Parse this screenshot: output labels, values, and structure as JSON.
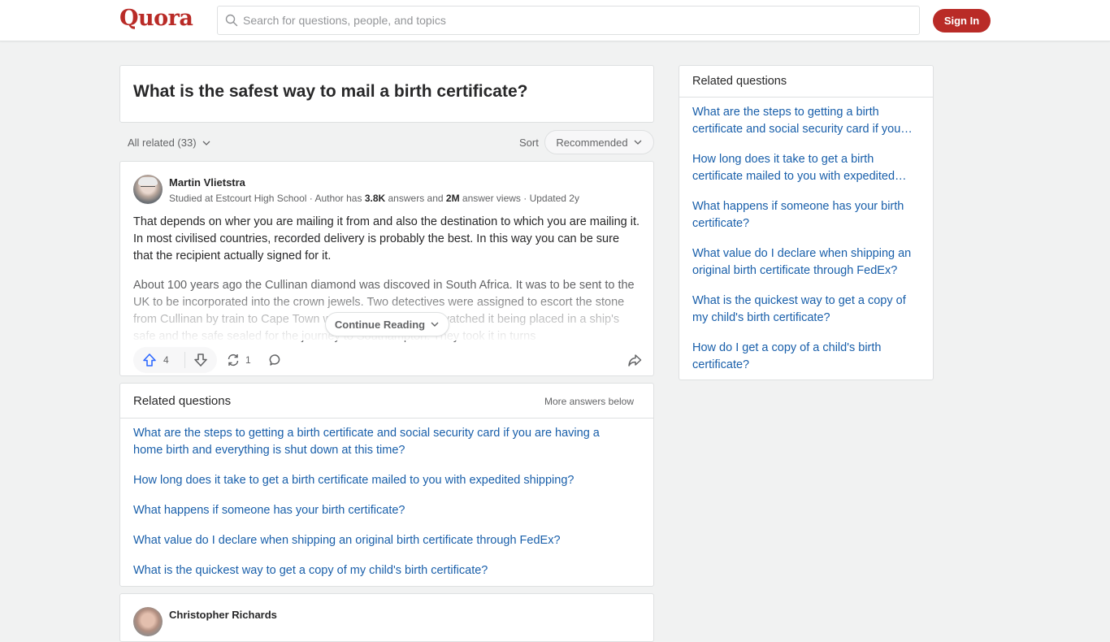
{
  "header": {
    "logo": "Quora",
    "search_placeholder": "Search for questions, people, and topics",
    "sign_in_label": "Sign In"
  },
  "question": {
    "title": "What is the safest way to mail a birth certificate?"
  },
  "filters": {
    "all_related_label": "All related (33)",
    "sort_label": "Sort",
    "sort_value": "Recommended"
  },
  "answer": {
    "author_name": "Martin Vlietstra",
    "credential": "Studied at Estcourt High School",
    "meta_prefix": " · Author has ",
    "answers_count": "3.8K",
    "meta_mid": " answers and ",
    "views_count": "2M",
    "meta_suffix": " answer views · Updated 2y",
    "paragraph_1": "That depends on wher you are mailing it from and also the destination to which you are mailing it. In most civilised countries, recorded delivery is probably the best. In this way you can be sure that the recipient actually signed for it.",
    "paragraph_2": "About 100 years ago the Cullinan diamond was discoved in South Africa. It was to be sent to the UK to be incorporated into the crown jewels. Two detectives were assigned to escort the stone from Cullinan by train to Cape Town where they personally watched it being placed in a ship's safe and the safe sealed for the journey to Southampton. They took it in turns",
    "continue_label": "Continue Reading",
    "upvotes": "4",
    "shares": "1"
  },
  "related_inline": {
    "title": "Related questions",
    "more_label": "More answers below",
    "items": [
      "What are the steps to getting a birth certificate and social security card if you are having a home birth and everything is shut down at this time?",
      "How long does it take to get a birth certificate mailed to you with expedited shipping?",
      "What happens if someone has your birth certificate?",
      "What value do I declare when shipping an original birth certificate through FedEx?",
      "What is the quickest way to get a copy of my child's birth certificate?"
    ]
  },
  "answer2": {
    "author_name": "Christopher Richards"
  },
  "sidebar": {
    "title": "Related questions",
    "items": [
      "What are the steps to getting a birth certificate and social security card if you…",
      "How long does it take to get a birth certificate mailed to you with expedited…",
      "What happens if someone has your birth certificate?",
      "What value do I declare when shipping an original birth certificate through FedEx?",
      "What is the quickest way to get a copy of my child's birth certificate?",
      "How do I get a copy of a child's birth certificate?"
    ]
  },
  "colors": {
    "brand": "#b92b27",
    "link": "#195faa",
    "upvote": "#2e69ff"
  }
}
